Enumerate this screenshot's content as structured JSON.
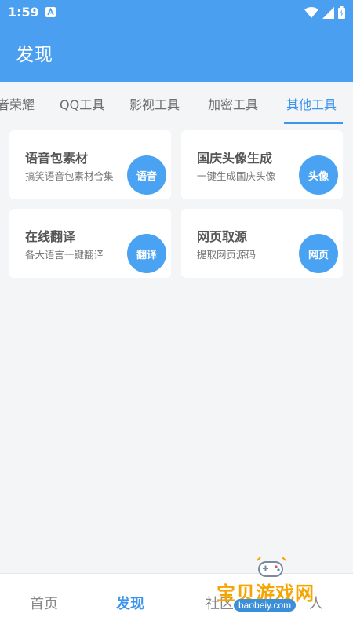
{
  "status": {
    "time": "1:59"
  },
  "app": {
    "title": "发现"
  },
  "tabs": [
    {
      "label": "者荣耀",
      "active": false
    },
    {
      "label": "QQ工具",
      "active": false
    },
    {
      "label": "影视工具",
      "active": false
    },
    {
      "label": "加密工具",
      "active": false
    },
    {
      "label": "其他工具",
      "active": true
    }
  ],
  "cards": [
    {
      "title": "语音包素材",
      "desc": "搞笑语音包素材合集",
      "badge": "语音"
    },
    {
      "title": "国庆头像生成",
      "desc": "一键生成国庆头像",
      "badge": "头像"
    },
    {
      "title": "在线翻译",
      "desc": "各大语言一键翻译",
      "badge": "翻译"
    },
    {
      "title": "网页取源",
      "desc": "提取网页源码",
      "badge": "网页"
    }
  ],
  "bottom_nav": [
    {
      "label": "首页",
      "active": false
    },
    {
      "label": "发现",
      "active": true
    },
    {
      "label": "社区",
      "active": false
    },
    {
      "label": "人",
      "active": false
    }
  ],
  "watermark": {
    "text": "宝贝游戏网",
    "url": "baobeiy.com"
  },
  "colors": {
    "primary": "#4a9ff0",
    "accent": "#3d95ec",
    "badge": "#4aa3f2",
    "background": "#f4f5f7",
    "watermark": "#f6a400"
  }
}
